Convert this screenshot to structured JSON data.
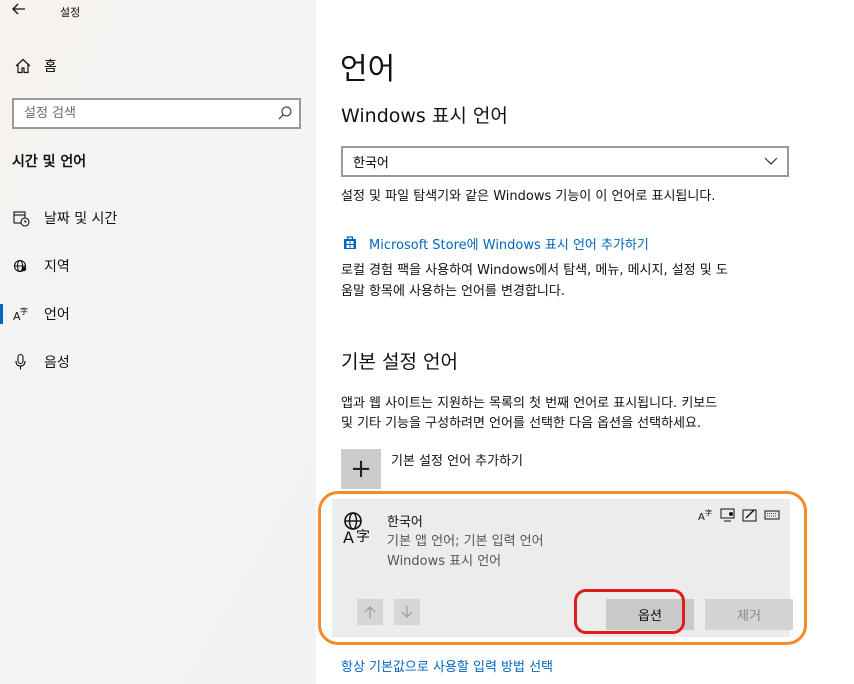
{
  "app": {
    "title": "설정"
  },
  "sidebar": {
    "home_label": "홈",
    "search_placeholder": "설정 검색",
    "section_title": "시간 및 언어",
    "items": [
      {
        "label": "날짜 및 시간",
        "icon": "calendar-clock-icon",
        "active": false
      },
      {
        "label": "지역",
        "icon": "globe-region-icon",
        "active": false
      },
      {
        "label": "언어",
        "icon": "language-icon",
        "active": true
      },
      {
        "label": "음성",
        "icon": "microphone-icon",
        "active": false
      }
    ]
  },
  "main": {
    "title": "언어",
    "display_language": {
      "heading": "Windows 표시 언어",
      "selected": "한국어",
      "description": "설정 및 파일 탐색기와 같은 Windows 기능이 이 언어로 표시됩니다.",
      "store_link": "Microsoft Store에 Windows 표시 언어 추가하기",
      "store_desc_line1": "로컬 경험 팩을 사용하여 Windows에서 탐색, 메뉴, 메시지, 설정 및 도",
      "store_desc_line2": "움말 항목에 사용하는 언어를 변경합니다."
    },
    "preferred_languages": {
      "heading": "기본 설정 언어",
      "desc_line1": "앱과 웹 사이트는 지원하는 목록의 첫 번째 언어로 표시됩니다. 키보드",
      "desc_line2": "및 기타 기능을 구성하려면 언어를 선택한 다음 옵션을 선택하세요.",
      "add_label": "기본 설정 언어 추가하기",
      "add_symbol": "+",
      "languages": [
        {
          "name": "한국어",
          "sub1": "기본 앱 언어; 기본 입력 언어",
          "sub2": "Windows 표시 언어",
          "options_label": "옵션",
          "remove_label": "제거"
        }
      ]
    },
    "footer_link": "항상 기본값으로 사용할 입력 방법 선택"
  },
  "colors": {
    "accent": "#0067c0",
    "highlight_orange": "#f28c28",
    "highlight_red": "#e01b1b"
  }
}
